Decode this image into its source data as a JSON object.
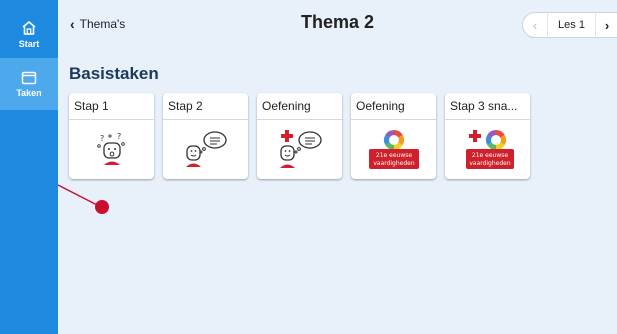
{
  "sidebar": {
    "items": [
      {
        "label": "Start",
        "icon": "home-icon",
        "active": false
      },
      {
        "label": "Taken",
        "icon": "window-icon",
        "active": true
      }
    ]
  },
  "header": {
    "back_label": "Thema's",
    "title": "Thema 2",
    "lesson_label": "Les 1"
  },
  "main": {
    "section_title": "Basistaken",
    "cards": [
      {
        "title": "Stap 1",
        "icon": "wondering-face-icon"
      },
      {
        "title": "Stap 2",
        "icon": "thinking-face-icon"
      },
      {
        "title": "Oefening",
        "icon": "thinking-plus-icon"
      },
      {
        "title": "Oefening",
        "icon": "skills-icon",
        "badge_lines": [
          "21e eeuwse",
          "vaardigheden"
        ]
      },
      {
        "title": "Stap 3 sna...",
        "icon": "skills-plus-icon",
        "badge_lines": [
          "21e eeuwse",
          "vaardigheden"
        ]
      }
    ]
  },
  "colors": {
    "sidebar": "#1d8ae0",
    "sidebar_active": "#4ea9ec",
    "content_bg": "#e8f1fa",
    "accent_red": "#d0202c",
    "section_title": "#1c3a5a"
  }
}
